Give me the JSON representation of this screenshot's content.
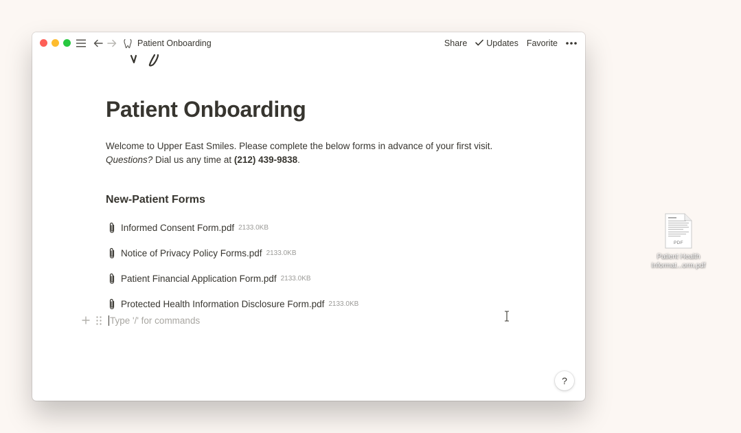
{
  "window": {
    "breadcrumb_title": "Patient Onboarding",
    "toolbar": {
      "share_label": "Share",
      "updates_label": "Updates",
      "favorite_label": "Favorite"
    }
  },
  "page": {
    "title": "Patient Onboarding",
    "intro": {
      "part1": "Welcome to Upper East Smiles. Please complete the below forms in advance of your first visit. ",
      "questions": "Questions?",
      "part2": " Dial us any time at ",
      "phone": "(212) 439-9838",
      "part3": "."
    },
    "section_heading": "New-Patient Forms",
    "files": [
      {
        "name": "Informed Consent Form.pdf",
        "size": "2133.0KB"
      },
      {
        "name": "Notice of Privacy Policy Forms.pdf",
        "size": "2133.0KB"
      },
      {
        "name": "Patient Financial Application Form.pdf",
        "size": "2133.0KB"
      },
      {
        "name": "Protected Health Information Disclosure Form.pdf",
        "size": "2133.0KB"
      }
    ],
    "command_placeholder": "Type '/' for commands",
    "help_label": "?"
  },
  "desktop": {
    "file": {
      "type_label": "PDF",
      "name_line1": "Patient Health",
      "name_line2": "Informat...orm.pdf"
    }
  },
  "colors": {
    "desktop_bg": "#fcf7f3",
    "text": "#37352f",
    "muted": "#9b9a97",
    "traffic_red": "#fe5f57",
    "traffic_yellow": "#febc2e",
    "traffic_green": "#28c840"
  },
  "icons": {
    "menu": "menu-icon",
    "back": "arrow-left-icon",
    "forward": "arrow-right-icon",
    "page": "tooth-icon",
    "updates": "checkmark-icon",
    "more": "more-dots-icon",
    "attachment": "paperclip-icon",
    "add": "plus-icon",
    "drag": "drag-handle-icon",
    "text_cursor": "text-cursor-icon",
    "pdf": "pdf-file-icon"
  }
}
